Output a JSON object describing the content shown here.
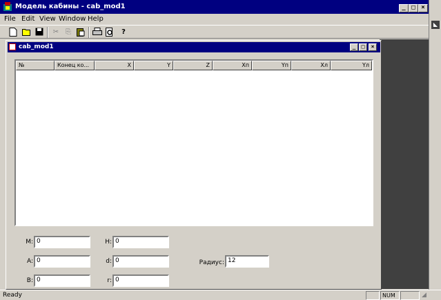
{
  "app": {
    "title": "Модель кабины - cab_mod1"
  },
  "menu": [
    {
      "label": "File",
      "mnemonic": "F"
    },
    {
      "label": "Edit",
      "mnemonic": "E"
    },
    {
      "label": "View",
      "mnemonic": "V"
    },
    {
      "label": "Window",
      "mnemonic": "W"
    },
    {
      "label": "Help",
      "mnemonic": "H"
    }
  ],
  "toolbar": [
    {
      "name": "new-icon",
      "glyph": "🗋"
    },
    {
      "name": "open-icon",
      "glyph": "📂"
    },
    {
      "name": "save-icon",
      "glyph": "💾"
    },
    {
      "name": "cut-icon",
      "glyph": "✂"
    },
    {
      "name": "copy-icon",
      "glyph": "⎘"
    },
    {
      "name": "paste-icon",
      "glyph": "📋"
    },
    {
      "name": "print-icon",
      "glyph": "🖶"
    },
    {
      "name": "print-preview-icon",
      "glyph": "🔍"
    },
    {
      "name": "help-icon",
      "glyph": "?"
    }
  ],
  "child": {
    "title": "cab_mod1"
  },
  "table": {
    "columns": [
      {
        "label": "№",
        "align": "left"
      },
      {
        "label": "Конец ко...",
        "align": "left"
      },
      {
        "label": "X",
        "align": "right"
      },
      {
        "label": "Y",
        "align": "right"
      },
      {
        "label": "Z",
        "align": "right"
      },
      {
        "label": "Xп",
        "align": "right"
      },
      {
        "label": "Yп",
        "align": "right"
      },
      {
        "label": "Xл",
        "align": "right"
      },
      {
        "label": "Yл",
        "align": "right"
      }
    ]
  },
  "fields": {
    "M": {
      "label": "M:",
      "value": "0"
    },
    "A": {
      "label": "A:",
      "value": "0"
    },
    "B": {
      "label": "B:",
      "value": "0"
    },
    "H": {
      "label": "H:",
      "value": "0"
    },
    "d": {
      "label": "d:",
      "value": "0"
    },
    "r": {
      "label": "r:",
      "value": "0"
    },
    "radius": {
      "label": "Радиус:",
      "value": "12"
    }
  },
  "status": {
    "ready": "Ready",
    "num": "NUM"
  }
}
